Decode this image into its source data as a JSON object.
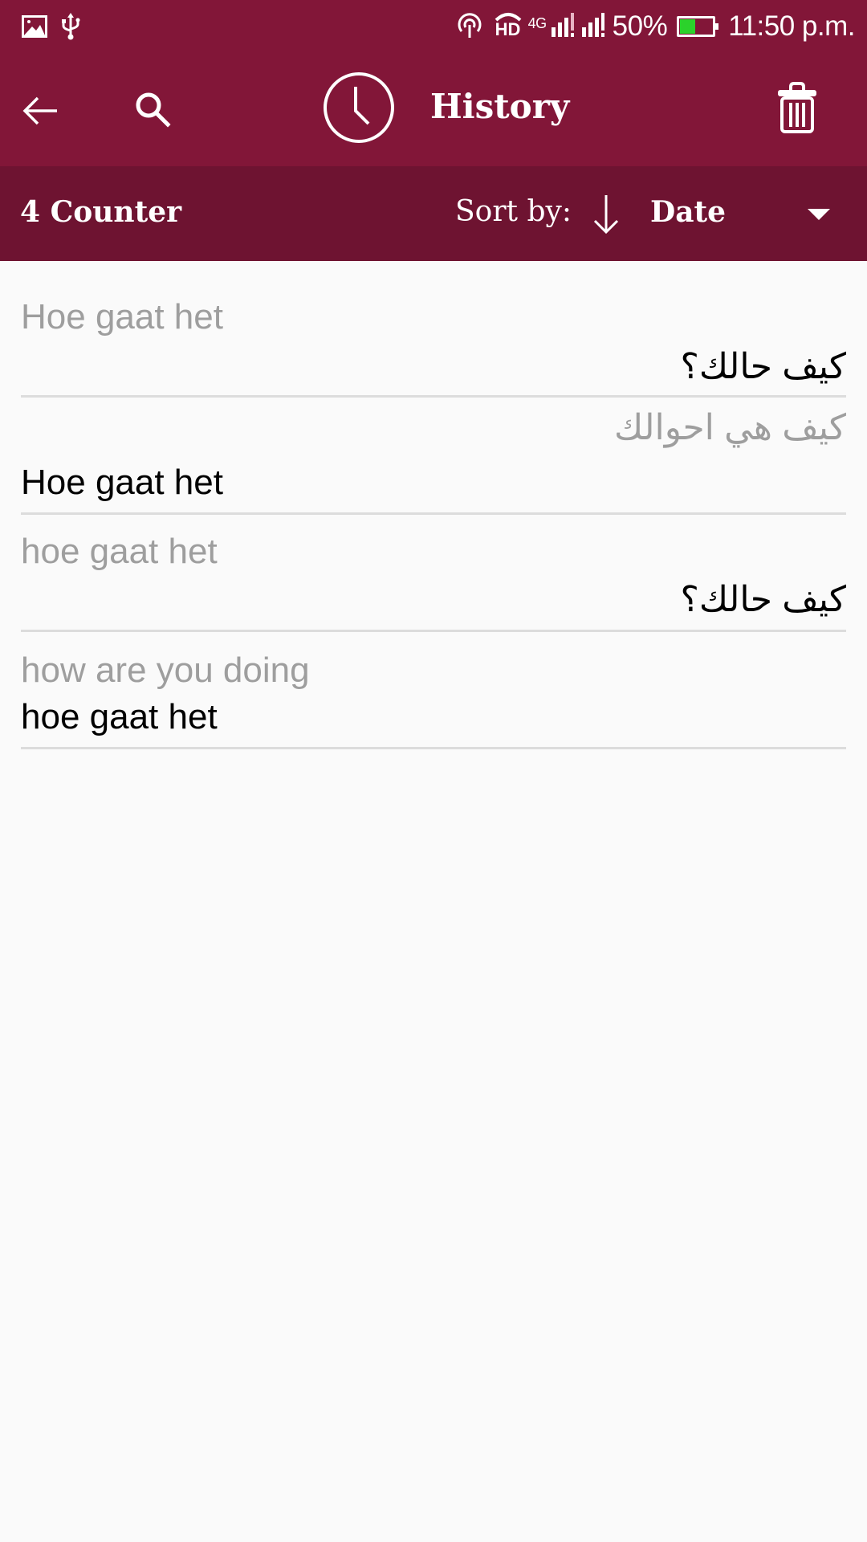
{
  "status_bar": {
    "left_icons": [
      "gallery-icon",
      "usb-icon"
    ],
    "right_icons": [
      "hotspot-icon",
      "hd-voice-icon",
      "signal-sim1-icon",
      "signal-sim2-icon",
      "battery-icon"
    ],
    "network": "4G",
    "hd_label": "HD",
    "battery_percent_text": "50%",
    "battery_level": 0.5,
    "battery_color": "#2bd22b",
    "time": "11:50 p.m."
  },
  "toolbar": {
    "back_icon": "arrow-back-icon",
    "search_icon": "search-icon",
    "clock_icon": "clock-icon",
    "title": "History",
    "delete_icon": "trash-icon",
    "color": "#821638"
  },
  "subheader": {
    "counter": "4 Counter",
    "sort_label": "Sort by:",
    "sort_direction_icon": "arrow-down-icon",
    "sort_value": "Date",
    "dropdown_icon": "triangle-down-icon",
    "color": "#6e1331"
  },
  "history": {
    "items": [
      {
        "source": "Hoe gaat het",
        "translation": "كيف حالك؟"
      },
      {
        "source": "كيف هي احوالك",
        "translation": "Hoe gaat het"
      },
      {
        "source": "hoe gaat het",
        "translation": "كيف حالك؟"
      },
      {
        "source": "how are you doing",
        "translation": "hoe gaat het"
      }
    ]
  }
}
